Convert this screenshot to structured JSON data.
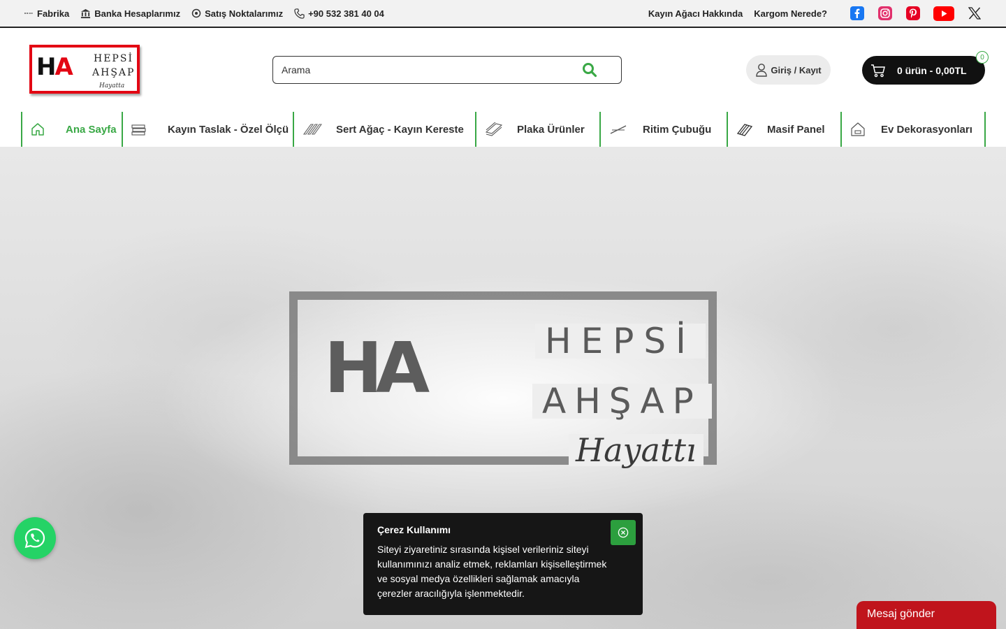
{
  "topbar": {
    "left": [
      {
        "label": "Fabrika",
        "icon": "dots-line-icon"
      },
      {
        "label": "Banka Hesaplarımız",
        "icon": "bank-icon"
      },
      {
        "label": "Satış Noktalarımız",
        "icon": "location-pin-icon"
      },
      {
        "label": "+90 532 381 40 04",
        "icon": "phone-icon"
      }
    ],
    "right_links": [
      "Kayın Ağacı Hakkında",
      "Kargom Nerede?"
    ],
    "social": [
      "facebook-icon",
      "instagram-icon",
      "pinterest-icon",
      "youtube-icon",
      "x-icon"
    ]
  },
  "logo": {
    "mark_h": "H",
    "mark_a": "A",
    "line1": "HEPSİ",
    "line2": "AHŞAP",
    "line3": "Hayatta"
  },
  "search": {
    "placeholder": "Arama"
  },
  "login": {
    "label": "Giriş / Kayıt"
  },
  "cart": {
    "label": "0 ürün - 0,00TL",
    "count": "0"
  },
  "nav": [
    {
      "label": "Ana Sayfa",
      "icon": "home-icon",
      "active": true
    },
    {
      "label": "Kayın Taslak - Özel Ölçü",
      "icon": "wood-stack-icon"
    },
    {
      "label": "Sert Ağaç - Kayın Kereste",
      "icon": "lumber-icon"
    },
    {
      "label": "Plaka Ürünler",
      "icon": "panel-sheets-icon"
    },
    {
      "label": "Ritim Çubuğu",
      "icon": "stick-icon"
    },
    {
      "label": "Masif Panel",
      "icon": "solid-panel-icon"
    },
    {
      "label": "Ev Dekorasyonları",
      "icon": "house-decor-icon"
    }
  ],
  "hero": {
    "mark": "HA",
    "word1": "HEPSİ",
    "word2": "AHŞAP",
    "word3": "Hayattı"
  },
  "cookie": {
    "title": "Çerez Kullanımı",
    "text": "Siteyi ziyaretiniz sırasında kişisel verileriniz siteyi kullanımınızı analiz etmek, reklamları kişiselleştirmek ve sosyal medya özellikleri sağlamak amacıyla çerezler aracılığıyla işlenmektedir."
  },
  "message": {
    "label": "Mesaj gönder"
  },
  "colors": {
    "accent": "#39a845",
    "brand_red": "#e30613",
    "cookie_bg": "#161616",
    "message_bg": "#c0141c",
    "whatsapp": "#25d366"
  }
}
